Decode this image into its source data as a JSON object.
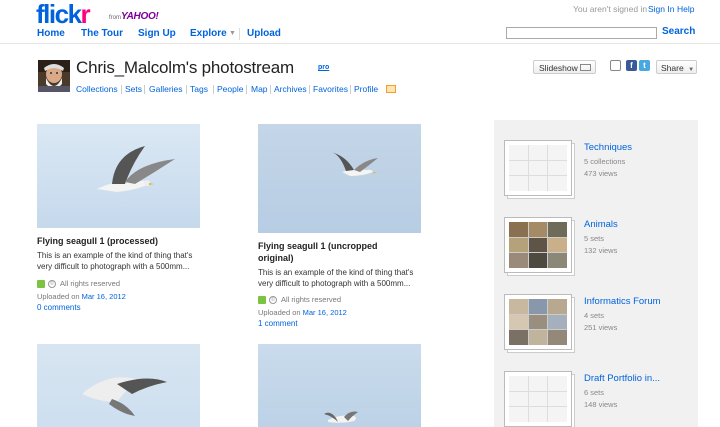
{
  "header": {
    "logo_prefix": "flick",
    "logo_suffix": "r",
    "logo_from": "from",
    "logo_yahoo": "YAHOO!",
    "signin_status": "You aren't signed in",
    "signin_label": "Sign In",
    "help_label": "Help",
    "nav": {
      "home": "Home",
      "tour": "The Tour",
      "signup": "Sign Up",
      "explore": "Explore",
      "upload": "Upload"
    },
    "search_value": "",
    "search_button": "Search"
  },
  "profile": {
    "title": "Chris_Malcolm's photostream",
    "pro_badge": "pro",
    "subnav": [
      "Collections",
      "Sets",
      "Galleries",
      "Tags",
      "People",
      "Map",
      "Archives",
      "Favorites",
      "Profile"
    ],
    "slideshow_label": "Slideshow",
    "share_label": "Share"
  },
  "photos": [
    {
      "title": "Flying seagull 1 (processed)",
      "description_line1": "This is an example of the kind of thing that's",
      "description_line2": "very difficult to photograph with a 500mm...",
      "license": "All rights reserved",
      "uploaded_prefix": "Uploaded on",
      "uploaded_date": "Mar 16, 2012",
      "comments": "0 comments"
    },
    {
      "title_line1": "Flying seagull 1 (uncropped",
      "title_line2": "original)",
      "description_line1": "This is an example of the kind of thing that's",
      "description_line2": "very difficult to photograph with a 500mm...",
      "license": "All rights reserved",
      "uploaded_prefix": "Uploaded on",
      "uploaded_date": "Mar 16, 2012",
      "comments": "1 comment"
    }
  ],
  "sidebar": {
    "items": [
      {
        "title": "Techniques",
        "count": "5 collections",
        "views": "473 views"
      },
      {
        "title": "Animals",
        "count": "5 sets",
        "views": "132 views"
      },
      {
        "title": "Informatics Forum",
        "count": "4 sets",
        "views": "251 views"
      },
      {
        "title": "Draft Portfolio in...",
        "count": "6 sets",
        "views": "148 views"
      }
    ]
  },
  "colors": {
    "link_blue": "#0063dc",
    "flickr_pink": "#ff0084",
    "sky": "#c8daec",
    "sidebar_bg": "#f1f1f1"
  }
}
